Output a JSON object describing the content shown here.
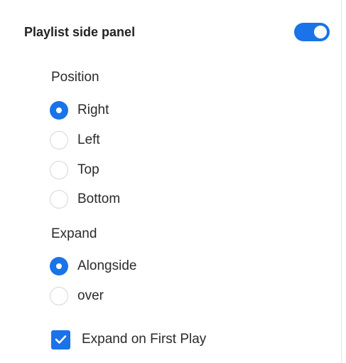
{
  "header": {
    "title": "Playlist side panel",
    "toggle_on": true,
    "accent_color": "#1a73e8"
  },
  "position": {
    "label": "Position",
    "options": [
      {
        "label": "Right",
        "checked": true
      },
      {
        "label": "Left",
        "checked": false
      },
      {
        "label": "Top",
        "checked": false
      },
      {
        "label": "Bottom",
        "checked": false
      }
    ]
  },
  "expand": {
    "label": "Expand",
    "options": [
      {
        "label": "Alongside",
        "checked": true
      },
      {
        "label": "over",
        "checked": false
      }
    ]
  },
  "expand_on_first_play": {
    "label": "Expand on First Play",
    "checked": true,
    "icon": "checkmark-icon"
  }
}
